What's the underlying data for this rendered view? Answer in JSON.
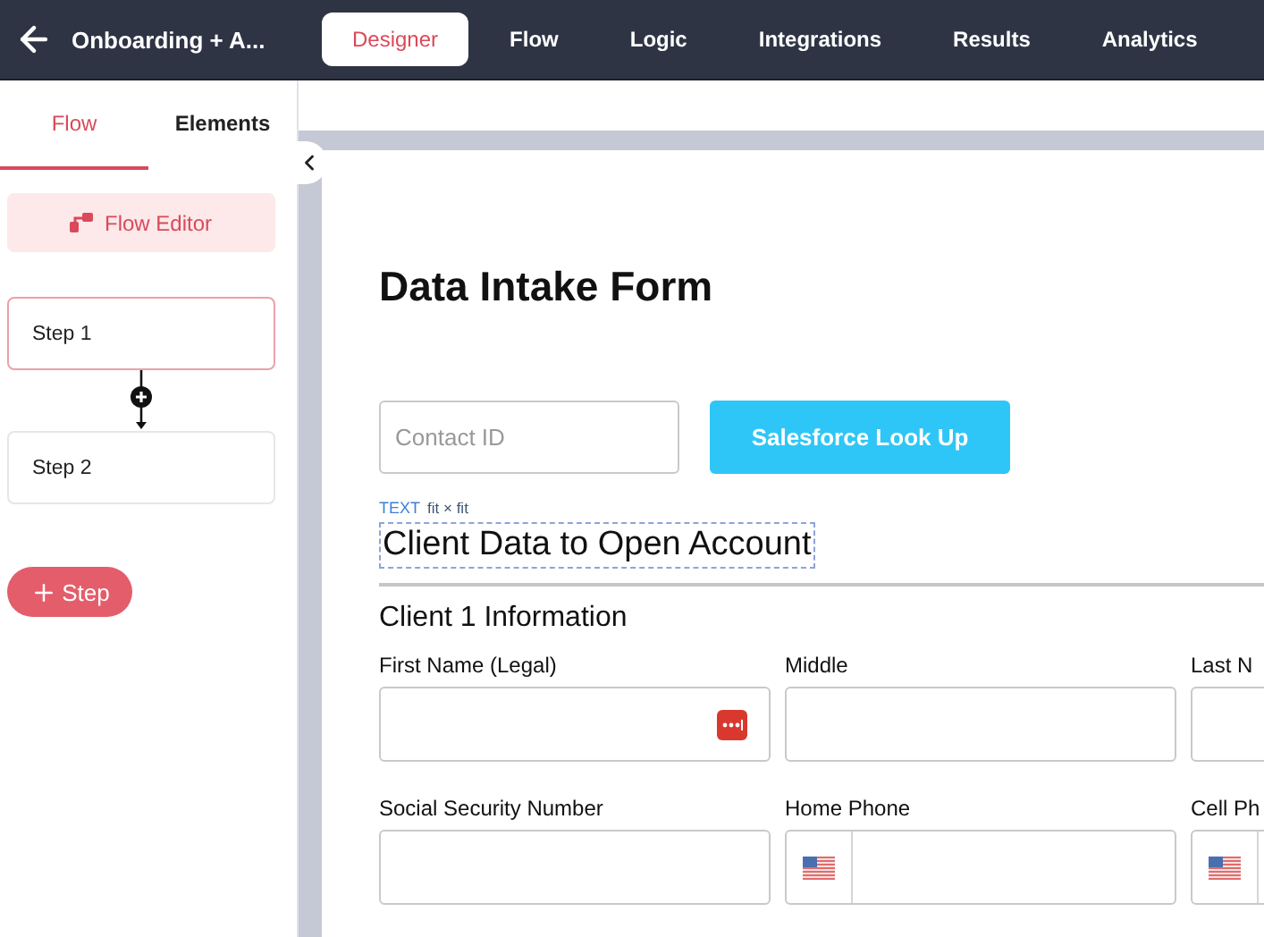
{
  "top_bar": {
    "title": "Onboarding + A...",
    "tabs": [
      {
        "label": "Designer",
        "selected": true
      },
      {
        "label": "Flow",
        "selected": false
      },
      {
        "label": "Logic",
        "selected": false
      },
      {
        "label": "Integrations",
        "selected": false
      },
      {
        "label": "Results",
        "selected": false
      },
      {
        "label": "Analytics",
        "selected": false
      }
    ]
  },
  "sidebar": {
    "tabs": [
      {
        "label": "Flow",
        "selected": true
      },
      {
        "label": "Elements",
        "selected": false
      }
    ],
    "flow_editor_button": "Flow Editor",
    "steps": [
      {
        "label": "Step 1",
        "selected": true
      },
      {
        "label": "Step 2",
        "selected": false
      }
    ],
    "add_step_button": "Step"
  },
  "form": {
    "title": "Data Intake Form",
    "contact_field": {
      "placeholder": "Contact ID"
    },
    "lookup_button": "Salesforce Look Up",
    "selection_tag": {
      "type": "TEXT",
      "size": "fit × fit"
    },
    "heading": "Client Data to Open Account",
    "section": "Client 1 Information",
    "fields": [
      {
        "label": "First Name (Legal)",
        "kind": "text",
        "password_icon": true
      },
      {
        "label": "Middle",
        "kind": "text"
      },
      {
        "label": "Last N",
        "kind": "text"
      },
      {
        "label": "Social Security Number",
        "kind": "text"
      },
      {
        "label": "Home Phone",
        "kind": "phone"
      },
      {
        "label": "Cell Ph",
        "kind": "phone"
      }
    ]
  }
}
